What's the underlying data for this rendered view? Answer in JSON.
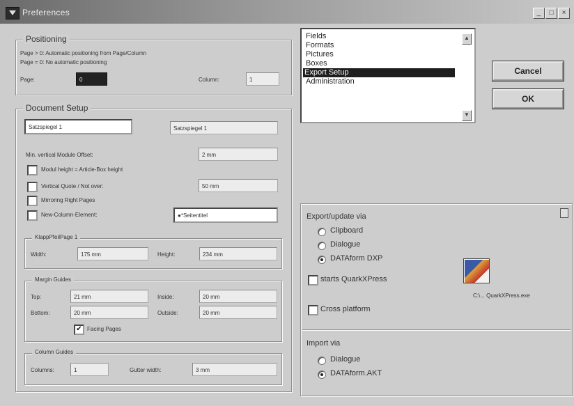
{
  "window": {
    "title": "Preferences",
    "minimize": "_",
    "maximize": "□",
    "close": "×"
  },
  "positioning": {
    "legend": "Positioning",
    "line1": "Page > 0: Automatic positioning from Page/Column",
    "line2": "Page = 0: No automatic positioning",
    "page_label": "Page:",
    "page_value": "0",
    "column_label": "Column:",
    "column_value": "1"
  },
  "document_setup": {
    "legend": "Document Setup",
    "field_left": "Satzspiegel 1",
    "field_right": "Satzspiegel 1",
    "vmo_label": "Min. vertical Module Offset:",
    "vmo_value": "2 mm",
    "modul_height_label": "Modul height = Article-Box height",
    "vertical_quote_label": "Vertical Quote / Not over:",
    "vertical_quote_value": "50 mm",
    "mirroring_label": "Mirroring Right Pages",
    "new_column_label": "New-Column-Element:",
    "new_column_value": "●*Seitentitel",
    "page_group": {
      "legend": "KlappPfeilPage 1",
      "width_label": "Width:",
      "width_value": "175 mm",
      "height_label": "Height:",
      "height_value": "234 mm"
    },
    "margin_guides": {
      "legend": "Margin Guides",
      "top_label": "Top:",
      "top_value": "21 mm",
      "inside_label": "Inside:",
      "inside_value": "20 mm",
      "bottom_label": "Bottom:",
      "bottom_value": "20 mm",
      "outside_label": "Outside:",
      "outside_value": "20 mm",
      "facing_label": "Facing Pages",
      "facing_mark": "✔"
    },
    "column_guides": {
      "legend": "Column Guides",
      "columns_label": "Columns:",
      "columns_value": "1",
      "gutter_label": "Gutter width:",
      "gutter_value": "3 mm"
    }
  },
  "category_list": {
    "items": [
      "Fields",
      "Formats",
      "Pictures",
      "Boxes",
      "Export Setup",
      "Administration"
    ],
    "selected_index": 4,
    "scroll_up": "▲",
    "scroll_down": "▼"
  },
  "buttons": {
    "cancel": "Cancel",
    "ok": "OK"
  },
  "export_panel": {
    "export_label": "Export/update via",
    "opt_clipboard": "Clipboard",
    "opt_dialogue": "Dialogue",
    "opt_dataform_dxp": "DATAform DXP",
    "starts_quark": "starts QuarkXPress",
    "app_path": "C:\\... QuarkXPress.exe",
    "cross_platform": "Cross platform",
    "import_label": "Import via",
    "import_dialogue": "Dialogue",
    "import_dataform": "DATAform.AKT"
  }
}
